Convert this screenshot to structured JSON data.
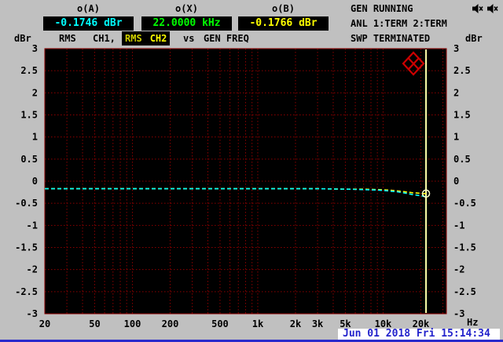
{
  "colors": {
    "background": "#c0c0c0",
    "plot_background": "#000000",
    "grid": "#8b0000",
    "ch1_trace": "#00ffff",
    "ch2_trace": "#ffff00",
    "cursor": "#ffffa8",
    "meter_a_value_color": "#00ffff",
    "meter_x_value_color": "#00ff00",
    "meter_b_value_color": "#ffff00",
    "datetime_blue": "#2222cc",
    "sweep_icon_red": "#cc0000"
  },
  "header": {
    "meter_a_title": "o(A)",
    "meter_x_title": "o(X)",
    "meter_b_title": "o(B)",
    "meter_a_value": "-0.1746 dBr",
    "meter_x_value": "22.0000 kHz",
    "meter_b_value": "-0.1766 dBr",
    "gen_status": "GEN RUNNING",
    "anl_status": "ANL 1:TERM 2:TERM",
    "swp_status": "SWP TERMINATED"
  },
  "icons": {
    "monitor_mute_left": "speaker-x-icon",
    "monitor_mute_right": "speaker-x-icon",
    "sweep_status": "red-diamond-x-icon"
  },
  "trace_title": {
    "ch1_detector": "RMS",
    "ch1_name": "CH1,",
    "ch2_detector": "RMS",
    "ch2_name": "CH2",
    "vs_label": "vs",
    "x_axis_name": "GEN FREQ"
  },
  "axis_units": {
    "left": "dBr",
    "right": "dBr",
    "x": "Hz"
  },
  "statusbar": {
    "datetime": "Jun 01 2018 Fri 15:14:34"
  },
  "chart_data": {
    "type": "line",
    "title": "RMS CH1, RMS CH2 vs GEN FREQ",
    "xlabel": "GEN FREQ",
    "ylabel": "dBr",
    "x_scale": "log",
    "x_range": [
      20,
      32000
    ],
    "y_range": [
      -3,
      3
    ],
    "y_step": 0.5,
    "grid": "dotted-dark-red",
    "legend": "none",
    "x_ticks": [
      {
        "v": 20,
        "label": "20"
      },
      {
        "v": 50,
        "label": "50"
      },
      {
        "v": 100,
        "label": "100"
      },
      {
        "v": 200,
        "label": "200"
      },
      {
        "v": 500,
        "label": "500"
      },
      {
        "v": 1000,
        "label": "1k"
      },
      {
        "v": 2000,
        "label": "2k"
      },
      {
        "v": 3000,
        "label": "3k"
      },
      {
        "v": 5000,
        "label": "5k"
      },
      {
        "v": 10000,
        "label": "10k"
      },
      {
        "v": 20000,
        "label": "20k"
      }
    ],
    "cursor_x_hz": 22000,
    "x": [
      20,
      30,
      50,
      100,
      200,
      500,
      1000,
      2000,
      3000,
      5000,
      7000,
      9000,
      11000,
      13000,
      15000,
      17000,
      19000,
      21000,
      22000
    ],
    "series": [
      {
        "name": "RMS CH1",
        "color": "#00ffff",
        "values": [
          -0.17,
          -0.17,
          -0.17,
          -0.17,
          -0.17,
          -0.17,
          -0.17,
          -0.17,
          -0.17,
          -0.18,
          -0.19,
          -0.2,
          -0.22,
          -0.24,
          -0.27,
          -0.3,
          -0.32,
          -0.34,
          -0.35
        ]
      },
      {
        "name": "RMS CH2",
        "color": "#ffff00",
        "end_marker": true,
        "values": [
          -0.17,
          -0.17,
          -0.17,
          -0.17,
          -0.17,
          -0.17,
          -0.17,
          -0.17,
          -0.17,
          -0.18,
          -0.18,
          -0.19,
          -0.2,
          -0.22,
          -0.24,
          -0.26,
          -0.27,
          -0.28,
          -0.28
        ]
      }
    ]
  }
}
